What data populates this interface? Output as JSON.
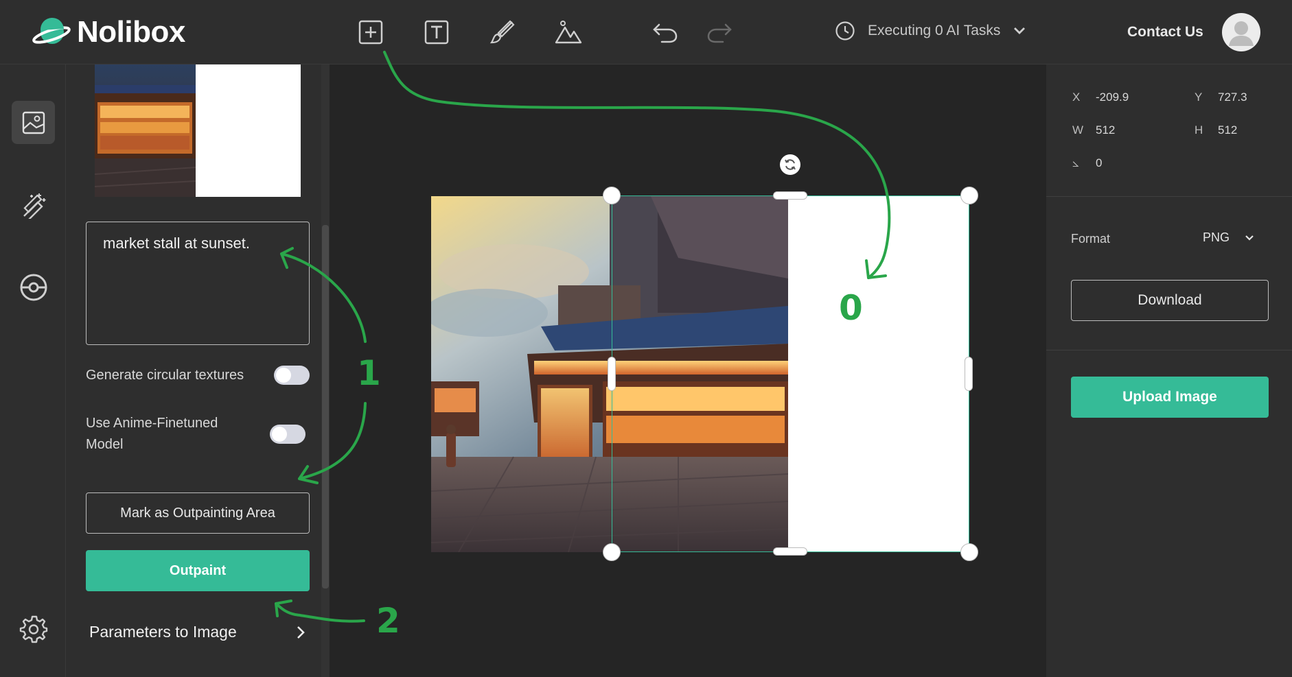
{
  "app": {
    "name": "Nolibox"
  },
  "toolbar": {
    "tools": [
      {
        "name": "add-frame",
        "icon": "square-plus-icon"
      },
      {
        "name": "add-text",
        "icon": "text-box-icon"
      },
      {
        "name": "brush",
        "icon": "brush-icon"
      },
      {
        "name": "image",
        "icon": "mountains-icon"
      },
      {
        "name": "undo",
        "icon": "undo-icon"
      },
      {
        "name": "redo",
        "icon": "redo-icon"
      }
    ],
    "tasks_label": "Executing 0 AI Tasks",
    "contact_label": "Contact Us"
  },
  "rail": {
    "items": [
      {
        "name": "image-panel",
        "icon": "image-icon",
        "active": true
      },
      {
        "name": "magic-wand",
        "icon": "magic-wand-icon",
        "active": false
      },
      {
        "name": "plugin",
        "icon": "target-icon",
        "active": false
      },
      {
        "name": "settings",
        "icon": "gear-icon",
        "active": false
      }
    ]
  },
  "panel": {
    "prompt": "market stall at sunset.",
    "toggles": [
      {
        "label": "Generate circular textures",
        "on": false
      },
      {
        "label": "Use Anime-Finetuned Model",
        "on": false
      }
    ],
    "mark_button": "Mark as Outpainting Area",
    "outpaint_button": "Outpaint",
    "params_link": "Parameters to Image"
  },
  "properties": {
    "x_label": "X",
    "x": "-209.9",
    "y_label": "Y",
    "y": "727.3",
    "w_label": "W",
    "w": "512",
    "h_label": "H",
    "h": "512",
    "angle_label": "⦣",
    "angle": "0"
  },
  "export": {
    "format_label": "Format",
    "format_value": "PNG",
    "download_button": "Download",
    "upload_button": "Upload Image"
  },
  "annotations": {
    "step0": "0",
    "step1": "1",
    "step2": "2"
  },
  "colors": {
    "accent": "#35bb97",
    "annotation": "#2aa64a",
    "background": "#252525",
    "panel": "#2e2e2e"
  }
}
